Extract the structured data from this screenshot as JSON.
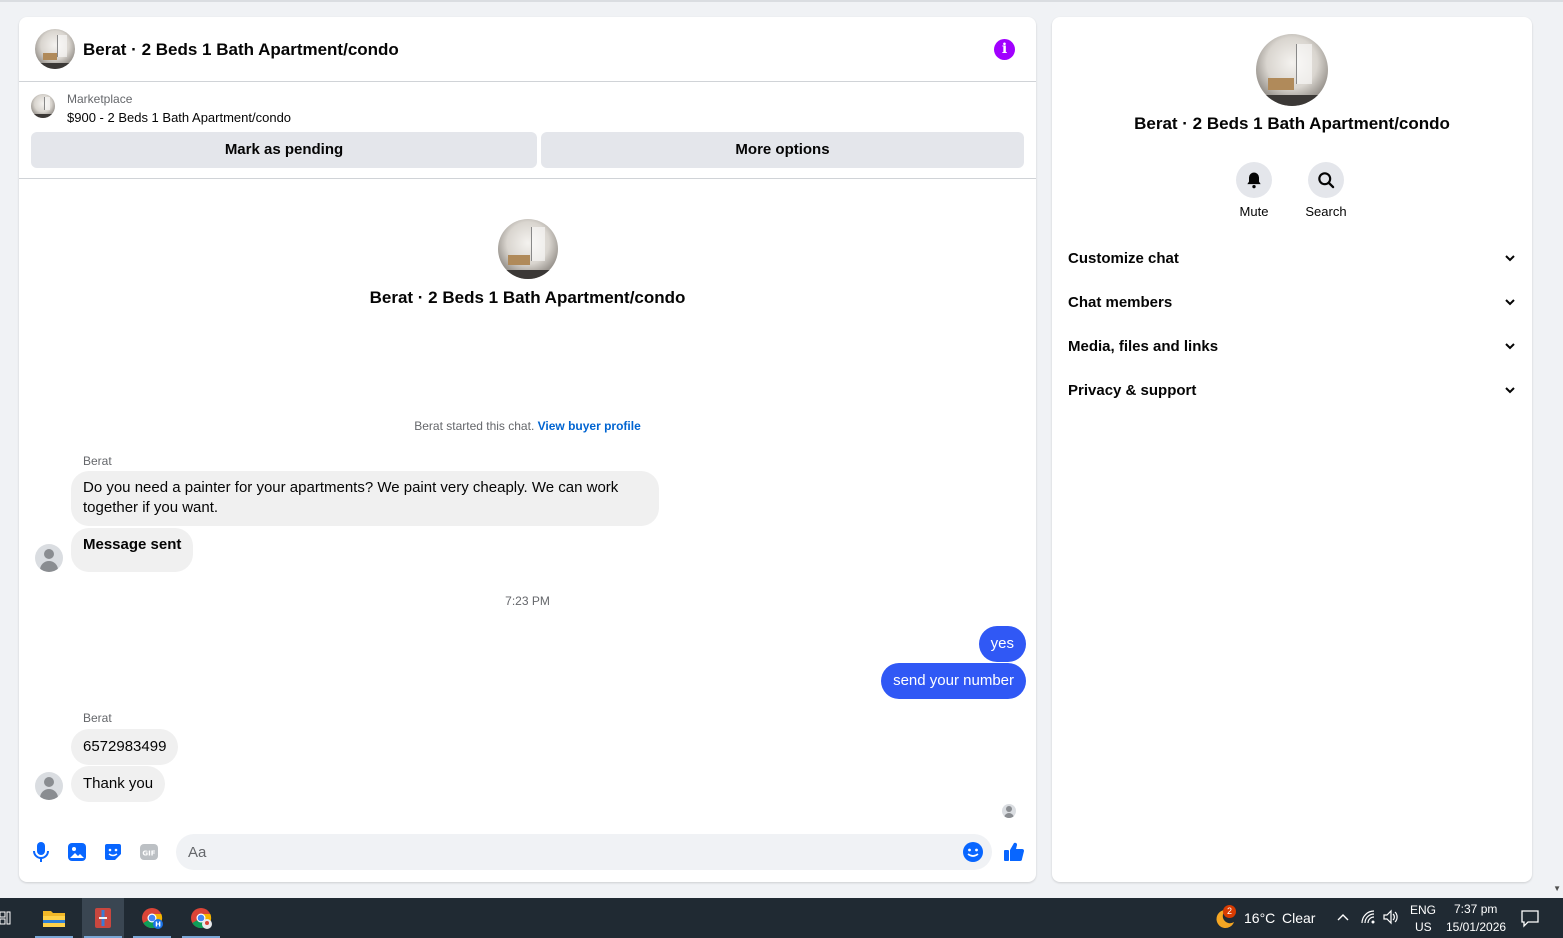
{
  "chat": {
    "header_title": "Berat · 2 Beds 1 Bath Apartment/condo",
    "info_icon_glyph": "i",
    "listing": {
      "kicker": "Marketplace",
      "text": "$900 - 2 Beds 1 Bath Apartment/condo"
    },
    "buttons": {
      "mark_pending": "Mark as pending",
      "more_options": "More options"
    },
    "intro_title": "Berat · 2 Beds 1 Bath Apartment/condo",
    "started_text": "Berat started this chat.",
    "started_link": "View buyer profile",
    "messages": [
      {
        "sender": "Berat",
        "text": "Do you need a painter for your apartments? We paint very cheaply. We can work together if you want."
      },
      {
        "text": "Message sent"
      },
      {
        "timestamp": "7:23 PM"
      },
      {
        "outgoing": true,
        "text": "yes"
      },
      {
        "outgoing": true,
        "text": "send your number"
      },
      {
        "sender": "Berat",
        "text": "6572983499"
      },
      {
        "text": "Thank you"
      }
    ],
    "composer": {
      "placeholder": "Aa"
    }
  },
  "info_panel": {
    "title": "Berat · 2 Beds 1 Bath Apartment/condo",
    "actions": [
      {
        "label": "Mute",
        "icon": "bell-icon"
      },
      {
        "label": "Search",
        "icon": "search-icon"
      }
    ],
    "sections": [
      "Customize chat",
      "Chat members",
      "Media, files and links",
      "Privacy & support"
    ]
  },
  "taskbar": {
    "weather_temp": "16°C",
    "weather_desc": "Clear",
    "weather_badge": "2",
    "lang": "ENG",
    "region": "US",
    "time": "7:37 pm",
    "date": "15/01/2026"
  },
  "colors": {
    "accent": "#0064d1",
    "outgoing_bubble": "#3058f5",
    "info_icon": "#a100ff",
    "composer_icons": "#0866ff"
  }
}
